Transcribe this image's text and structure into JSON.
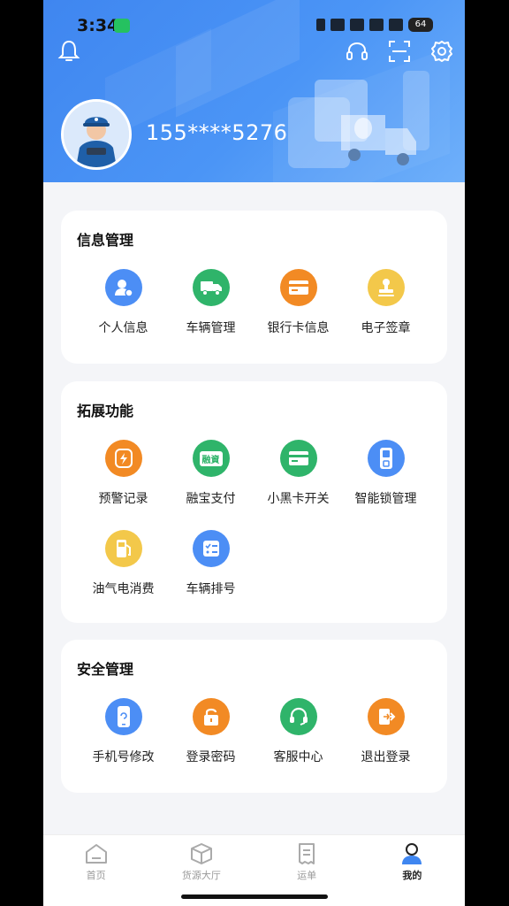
{
  "status": {
    "time": "3:34",
    "battery": "64"
  },
  "user": {
    "phone": "155****5276"
  },
  "sections": {
    "info": {
      "title": "信息管理",
      "items": [
        "个人信息",
        "车辆管理",
        "银行卡信息",
        "电子签章"
      ]
    },
    "ext": {
      "title": "拓展功能",
      "items": [
        "预警记录",
        "融宝支付",
        "小黑卡开关",
        "智能锁管理",
        "油气电消费",
        "车辆排号"
      ],
      "rongbao_badge": "融資"
    },
    "security": {
      "title": "安全管理",
      "items": [
        "手机号修改",
        "登录密码",
        "客服中心",
        "退出登录"
      ]
    }
  },
  "tabbar": {
    "tabs": [
      "首页",
      "货源大厅",
      "运单",
      "我的"
    ],
    "active": "我的"
  },
  "colors": {
    "header_blue": "#4b95f6",
    "blue": "#3f86f0",
    "green": "#2fb46a",
    "orange": "#f28a24",
    "yellow": "#f3c84a"
  }
}
